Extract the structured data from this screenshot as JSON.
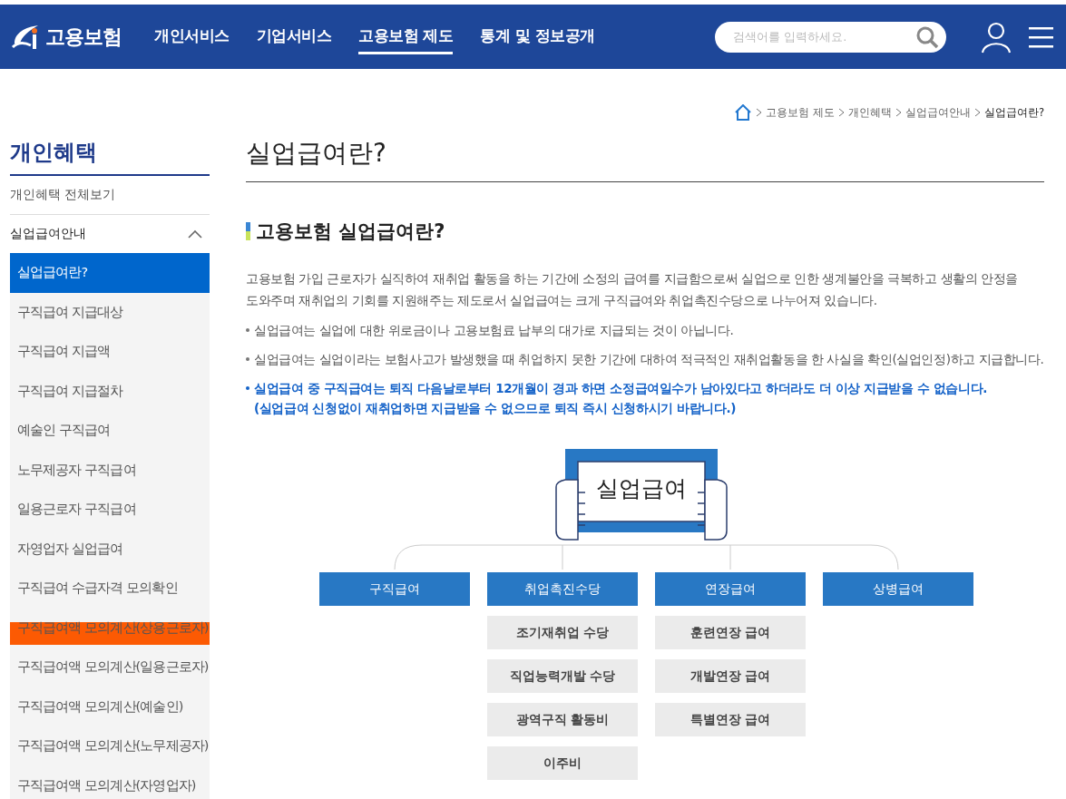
{
  "header": {
    "logo_text": "고용보험",
    "nav": [
      {
        "label": "개인서비스",
        "selected": false
      },
      {
        "label": "기업서비스",
        "selected": false
      },
      {
        "label": "고용보험 제도",
        "selected": true
      },
      {
        "label": "통계 및 정보공개",
        "selected": false
      }
    ],
    "search": {
      "placeholder": "검색어를 입력하세요."
    }
  },
  "breadcrumb": [
    "고용보험 제도",
    "개인혜택",
    "실업급여안내",
    "실업급여란?"
  ],
  "sidebar": {
    "title": "개인혜택",
    "all_link": "개인혜택 전체보기",
    "group": {
      "label": "실업급여안내",
      "expanded": true,
      "items": [
        {
          "label": "실업급여란?",
          "selected": true,
          "highlighted": false
        },
        {
          "label": "구직급여 지급대상",
          "selected": false,
          "highlighted": false
        },
        {
          "label": "구직급여 지급액",
          "selected": false,
          "highlighted": false
        },
        {
          "label": "구직급여 지급절차",
          "selected": false,
          "highlighted": false
        },
        {
          "label": "예술인 구직급여",
          "selected": false,
          "highlighted": false
        },
        {
          "label": "노무제공자 구직급여",
          "selected": false,
          "highlighted": false
        },
        {
          "label": "일용근로자 구직급여",
          "selected": false,
          "highlighted": false
        },
        {
          "label": "자영업자 실업급여",
          "selected": false,
          "highlighted": false
        },
        {
          "label": "구직급여 수급자격 모의확인",
          "selected": false,
          "highlighted": false
        },
        {
          "label": "구직급여액 모의계산(상용근로자)",
          "selected": false,
          "highlighted": true
        },
        {
          "label": "구직급여액 모의계산(일용근로자)",
          "selected": false,
          "highlighted": false
        },
        {
          "label": "구직급여액 모의계산(예술인)",
          "selected": false,
          "highlighted": false
        },
        {
          "label": "구직급여액 모의계산(노무제공자)",
          "selected": false,
          "highlighted": false
        },
        {
          "label": "구직급여액 모의계산(자영업자)",
          "selected": false,
          "highlighted": false
        }
      ]
    }
  },
  "content": {
    "title": "실업급여란?",
    "section_title": "고용보험 실업급여란?",
    "intro": "고용보험 가입 근로자가 실직하여 재취업 활동을 하는 기간에 소정의 급여를 지급함으로써 실업으로 인한 생계불안을 극복하고 생활의 안정을 도와주며 재취업의 기회를 지원해주는 제도로서 실업급여는 크게 구직급여와 취업촉진수당으로 나누어져 있습니다.",
    "bullets": [
      {
        "text": "실업급여는 실업에 대한 위로금이나 고용보험료 납부의 대가로 지급되는 것이 아닙니다.",
        "emphasis": false
      },
      {
        "text": "실업급여는 실업이라는 보험사고가 발생했을 때 취업하지 못한 기간에 대하여 적극적인 재취업활동을 한 사실을 확인(실업인정)하고 지급합니다.",
        "emphasis": false
      },
      {
        "text": "실업급여 중 구직급여는 퇴직 다음날로부터 12개월이 경과 하면 소정급여일수가 남아있다고 하더라도 더 이상 지급받을 수 없습니다.",
        "note": "(실업급여 신청없이 재취업하면 지급받을 수 없으므로 퇴직 즉시 신청하시기 바랍니다.)",
        "emphasis": true
      }
    ],
    "diagram": {
      "center": "실업급여",
      "categories": [
        {
          "label": "구직급여"
        },
        {
          "label": "취업촉진수당",
          "children": [
            "조기재취업 수당",
            "직업능력개발 수당",
            "광역구직 활동비",
            "이주비"
          ]
        },
        {
          "label": "연장급여",
          "children": [
            "훈련연장 급여",
            "개발연장 급여",
            "특별연장 급여"
          ]
        },
        {
          "label": "상병급여"
        }
      ]
    }
  }
}
